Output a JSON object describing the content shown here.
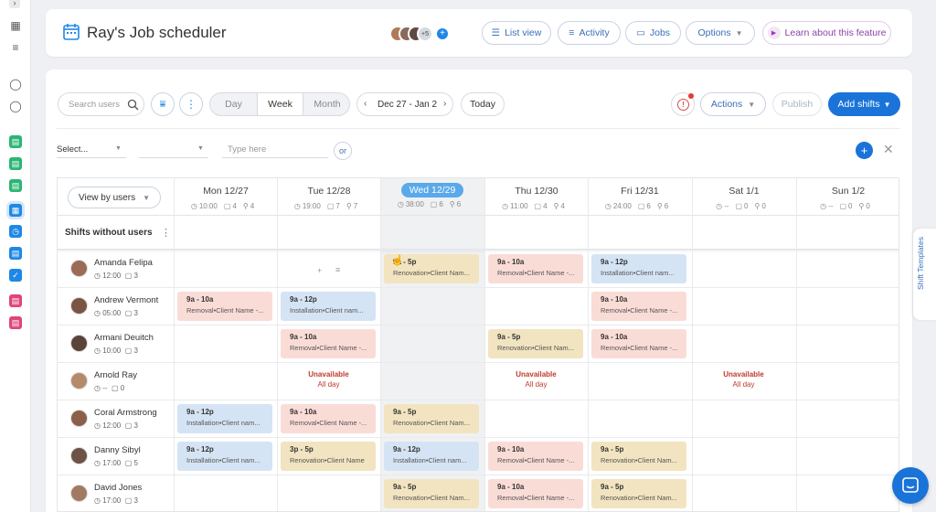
{
  "app": {
    "title": "Ray's Job scheduler"
  },
  "header": {
    "avatars_more": "+5",
    "buttons": {
      "list_view": "List view",
      "activity": "Activity",
      "jobs": "Jobs",
      "options": "Options",
      "learn": "Learn about this feature"
    }
  },
  "toolbar": {
    "search_placeholder": "Search users",
    "view_day": "Day",
    "view_week": "Week",
    "view_month": "Month",
    "date_range": "Dec 27 - Jan 2",
    "today": "Today",
    "actions": "Actions",
    "publish": "Publish",
    "add_shifts": "Add shifts"
  },
  "filters": {
    "select_label": "Select...",
    "type_placeholder": "Type here",
    "or": "or"
  },
  "grid": {
    "view_by": "View by users",
    "shifts_without_users": "Shifts without users",
    "side_tab": "Shift Templates",
    "days": [
      {
        "name": "Mon 12/27",
        "time": "10:00",
        "shifts": "4",
        "users": "4",
        "highlight": false
      },
      {
        "name": "Tue 12/28",
        "time": "19:00",
        "shifts": "7",
        "users": "7",
        "highlight": false
      },
      {
        "name": "Wed 12/29",
        "time": "38:00",
        "shifts": "6",
        "users": "6",
        "highlight": true
      },
      {
        "name": "Thu 12/30",
        "time": "11:00",
        "shifts": "4",
        "users": "4",
        "highlight": false
      },
      {
        "name": "Fri 12/31",
        "time": "24:00",
        "shifts": "6",
        "users": "6",
        "highlight": false
      },
      {
        "name": "Sat 1/1",
        "time": "--",
        "shifts": "0",
        "users": "0",
        "highlight": false
      },
      {
        "name": "Sun 1/2",
        "time": "--",
        "shifts": "0",
        "users": "0",
        "highlight": false
      }
    ],
    "users": [
      {
        "name": "Amanda Felipa",
        "time": "12:00",
        "count": "3"
      },
      {
        "name": "Andrew Vermont",
        "time": "05:00",
        "count": "3"
      },
      {
        "name": "Armani Deuitch",
        "time": "10:00",
        "count": "3"
      },
      {
        "name": "Arnold Ray",
        "time": "--",
        "count": "0"
      },
      {
        "name": "Coral Armstrong",
        "time": "12:00",
        "count": "3"
      },
      {
        "name": "Danny Sibyl",
        "time": "17:00",
        "count": "5"
      },
      {
        "name": "David Jones",
        "time": "17:00",
        "count": "3"
      }
    ],
    "shifts": {
      "amanda_wed": {
        "time": "9a - 5p",
        "desc": "Renovation•Client Nam..."
      },
      "amanda_thu": {
        "time": "9a - 10a",
        "desc": "Removal•Client Name -..."
      },
      "amanda_fri": {
        "time": "9a - 12p",
        "desc": "Installation•Client nam..."
      },
      "andrew_mon": {
        "time": "9a - 10a",
        "desc": "Removal•Client Name -..."
      },
      "andrew_tue": {
        "time": "9a - 12p",
        "desc": "Installation•Client nam..."
      },
      "andrew_fri": {
        "time": "9a - 10a",
        "desc": "Removal•Client Name -..."
      },
      "armani_tue": {
        "time": "9a - 10a",
        "desc": "Removal•Client Name -..."
      },
      "armani_thu": {
        "time": "9a - 5p",
        "desc": "Renovation•Client Nam..."
      },
      "armani_fri": {
        "time": "9a - 10a",
        "desc": "Removal•Client Name -..."
      },
      "coral_mon": {
        "time": "9a - 12p",
        "desc": "Installation•Client nam..."
      },
      "coral_tue": {
        "time": "9a - 10a",
        "desc": "Removal•Client Name -..."
      },
      "coral_wed": {
        "time": "9a - 5p",
        "desc": "Renovation•Client Nam..."
      },
      "danny_mon": {
        "time": "9a - 12p",
        "desc": "Installation•Client nam..."
      },
      "danny_tue": {
        "time": "3p - 5p",
        "desc": "Renovation•Client Name"
      },
      "danny_wed": {
        "time": "9a - 12p",
        "desc": "Installation•Client nam..."
      },
      "danny_thu": {
        "time": "9a - 10a",
        "desc": "Removal•Client Name -..."
      },
      "danny_fri": {
        "time": "9a - 5p",
        "desc": "Renovation•Client Nam..."
      },
      "david_wed": {
        "time": "9a - 5p",
        "desc": "Renovation•Client Nam..."
      },
      "david_thu": {
        "time": "9a - 10a",
        "desc": "Removal•Client Name -..."
      },
      "david_fri": {
        "time": "9a - 5p",
        "desc": "Renovation•Client Nam..."
      }
    },
    "unavailable": {
      "label": "Unavailable",
      "sub": "All day"
    }
  },
  "colors": {
    "accent": "#1a73d9",
    "shift_red": "#fadcd6",
    "shift_blue": "#d5e4f4",
    "shift_yellow": "#f2e4c0"
  }
}
